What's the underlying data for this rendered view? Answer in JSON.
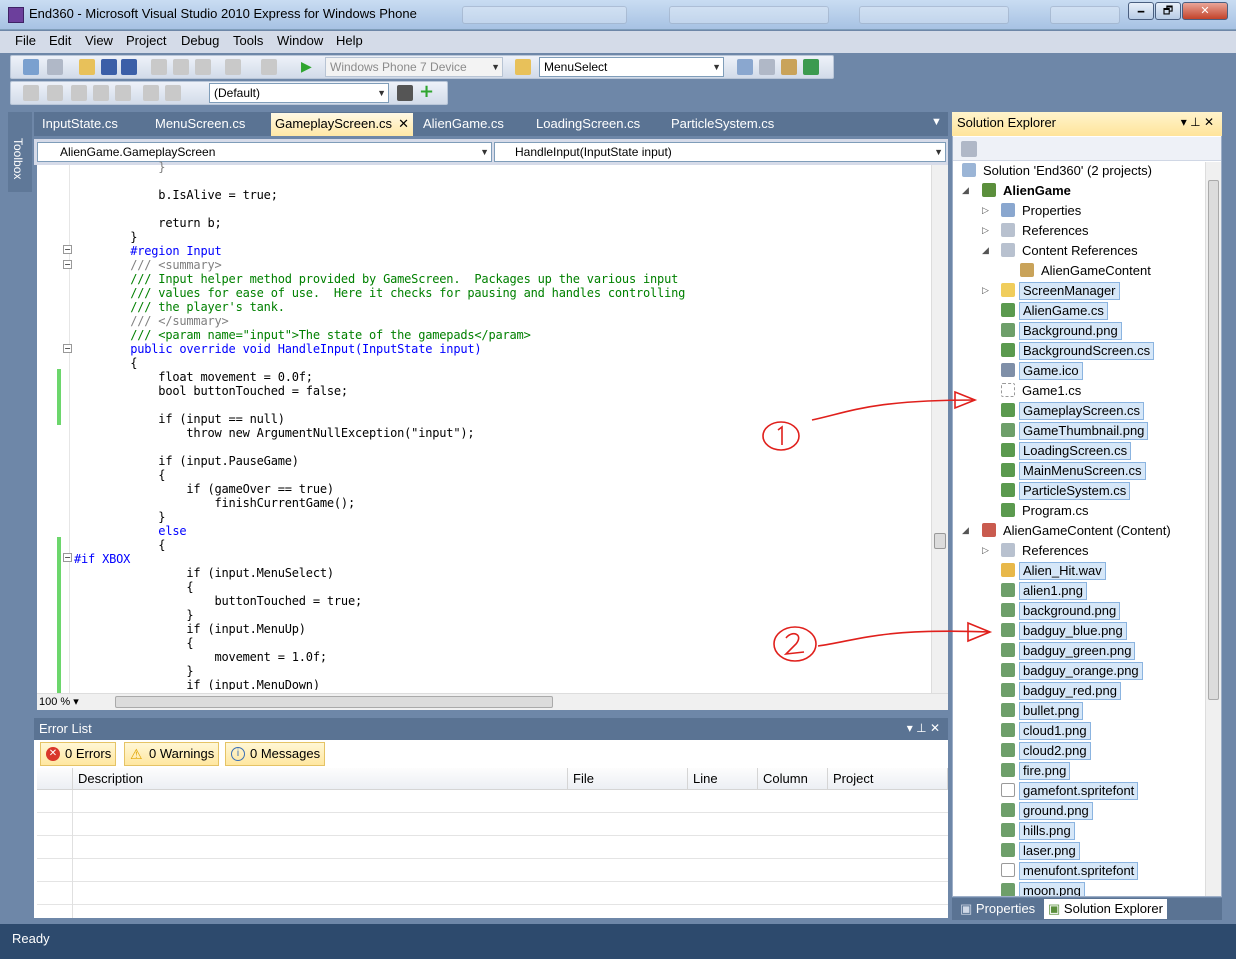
{
  "window": {
    "title": "End360 - Microsoft Visual Studio 2010 Express for Windows Phone",
    "icon_label": "",
    "min": "🗕",
    "max": "🗗",
    "close": "✕"
  },
  "menu": [
    "File",
    "Edit",
    "View",
    "Project",
    "Debug",
    "Tools",
    "Window",
    "Help"
  ],
  "toolbar": {
    "device_combo": "Windows Phone 7 Device",
    "find_combo": "MenuSelect",
    "config_combo": "(Default)"
  },
  "toolbox_label": "Toolbox",
  "doc_tabs": [
    {
      "label": "InputState.cs"
    },
    {
      "label": "MenuScreen.cs"
    },
    {
      "label": "GameplayScreen.cs",
      "close": "✕"
    },
    {
      "label": "AlienGame.cs"
    },
    {
      "label": "LoadingScreen.cs"
    },
    {
      "label": "ParticleSystem.cs"
    }
  ],
  "editor": {
    "type_combo": "AlienGame.GameplayScreen",
    "member_combo": "HandleInput(InputState input)",
    "zoom": "100 %",
    "code": [
      "            b.IsAlive = true;",
      "",
      "            return b;",
      "        }",
      "        #region Input",
      "        /// <summary>",
      "        /// Input helper method provided by GameScreen.  Packages up the various input",
      "        /// values for ease of use.  Here it checks for pausing and handles controlling",
      "        /// the player's tank.",
      "        /// </summary>",
      "        /// <param name=\"input\">The state of the gamepads</param>",
      "        public override void HandleInput(InputState input)",
      "        {",
      "            float movement = 0.0f;",
      "            bool buttonTouched = false;",
      "",
      "            if (input == null)",
      "                throw new ArgumentNullException(\"input\");",
      "",
      "            if (input.PauseGame)",
      "            {",
      "                if (gameOver == true)",
      "                    finishCurrentGame();",
      "            }",
      "            else",
      "            {",
      "#if XBOX",
      "                if (input.MenuSelect)",
      "                {",
      "                    buttonTouched = true;",
      "                }",
      "                if (input.MenuUp)",
      "                {",
      "                    movement = 1.0f;",
      "                }",
      "                if (input.MenuDown)"
    ]
  },
  "error_list": {
    "title": "Error List",
    "errors": "0 Errors",
    "warnings": "0 Warnings",
    "messages": "0 Messages",
    "columns": [
      "Description",
      "File",
      "Line",
      "Column",
      "Project"
    ]
  },
  "solution_explorer": {
    "title": "Solution Explorer",
    "items": [
      {
        "label": "Solution 'End360' (2 projects)"
      },
      {
        "label": "AlienGame"
      },
      {
        "label": "Properties"
      },
      {
        "label": "References"
      },
      {
        "label": "Content References"
      },
      {
        "label": "AlienGameContent"
      },
      {
        "label": "ScreenManager"
      },
      {
        "label": "AlienGame.cs"
      },
      {
        "label": "Background.png"
      },
      {
        "label": "BackgroundScreen.cs"
      },
      {
        "label": "Game.ico"
      },
      {
        "label": "Game1.cs"
      },
      {
        "label": "GameplayScreen.cs"
      },
      {
        "label": "GameThumbnail.png"
      },
      {
        "label": "LoadingScreen.cs"
      },
      {
        "label": "MainMenuScreen.cs"
      },
      {
        "label": "ParticleSystem.cs"
      },
      {
        "label": "Program.cs"
      },
      {
        "label": "AlienGameContent (Content)"
      },
      {
        "label": "References"
      },
      {
        "label": "Alien_Hit.wav"
      },
      {
        "label": "alien1.png"
      },
      {
        "label": "background.png"
      },
      {
        "label": "badguy_blue.png"
      },
      {
        "label": "badguy_green.png"
      },
      {
        "label": "badguy_orange.png"
      },
      {
        "label": "badguy_red.png"
      },
      {
        "label": "bullet.png"
      },
      {
        "label": "cloud1.png"
      },
      {
        "label": "cloud2.png"
      },
      {
        "label": "fire.png"
      },
      {
        "label": "gamefont.spritefont"
      },
      {
        "label": "ground.png"
      },
      {
        "label": "hills.png"
      },
      {
        "label": "laser.png"
      },
      {
        "label": "menufont.spritefont"
      },
      {
        "label": "moon.png"
      }
    ],
    "bottom_tabs": [
      "Properties",
      "Solution Explorer"
    ]
  },
  "status": "Ready",
  "colors": {
    "annotation": "#e0201c",
    "accent": "#ffe49b"
  }
}
